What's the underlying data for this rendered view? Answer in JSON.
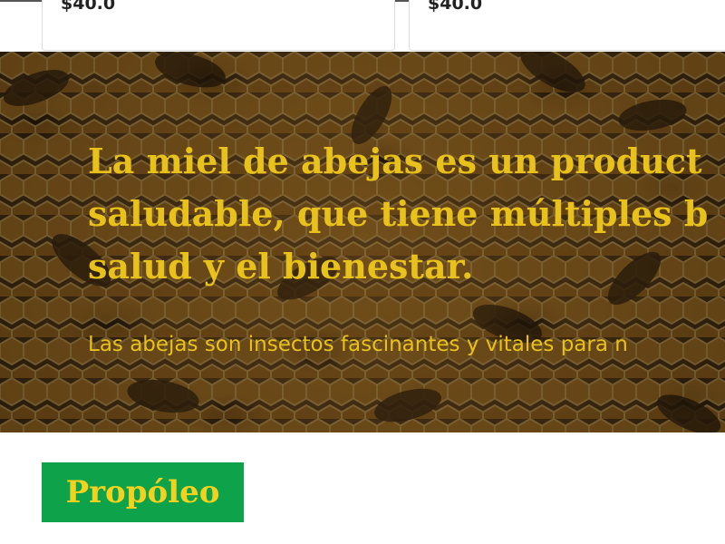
{
  "products": [
    {
      "price": "$40.0"
    },
    {
      "price": "$40.0"
    }
  ],
  "hero": {
    "title_lines": [
      "La miel de abejas es un product",
      "saludable, que tiene múltiples b",
      "salud y el bienestar."
    ],
    "text": "Las abejas son insectos fascinantes y vitales para n",
    "text_color": "#e8c21a",
    "background": "honeycomb with bees"
  },
  "section_button": {
    "label": "Propóleo",
    "background_color": "#0ea34a",
    "text_color": "#f2d21e"
  }
}
